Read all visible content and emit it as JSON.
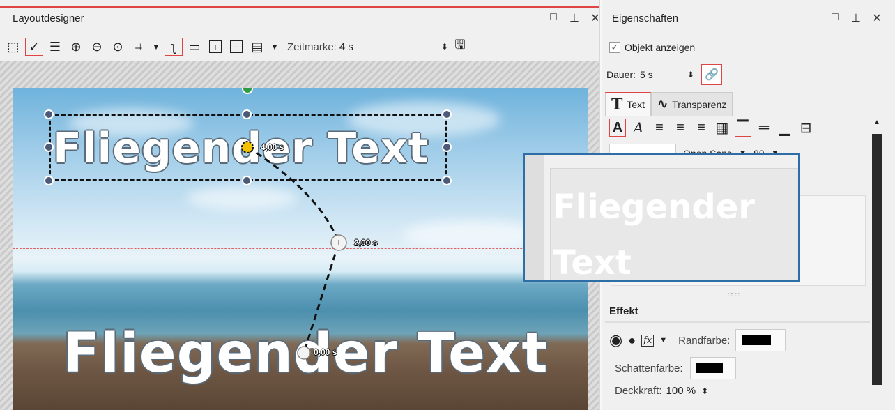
{
  "layoutdesigner": {
    "title": "Layoutdesigner",
    "window_buttons": [
      "□",
      "⊥",
      "✕"
    ],
    "toolbar": {
      "zeitmarke_label": "Zeitmarke:",
      "zeitmarke_value": "4 s"
    },
    "canvas": {
      "text_top": "Fliegender Text",
      "text_bottom": "Fliegender Text",
      "time_label_top": "4,00 s",
      "time_label_mid": "2,00 s",
      "time_label_bottom": "0,00 s"
    }
  },
  "eigenschaften": {
    "title": "Eigenschaften",
    "window_buttons": [
      "□",
      "⊥",
      "✕"
    ],
    "objekt_anzeigen": "Objekt anzeigen",
    "dauer_label": "Dauer:",
    "dauer_value": "5 s",
    "tabs": [
      {
        "icon": "T",
        "label": "Text"
      },
      {
        "icon": "∿",
        "label": "Transparenz"
      }
    ],
    "font_name": "Open Sans",
    "font_size": "80",
    "text_content": "Fliegender Text",
    "effekt_title": "Effekt",
    "randfarbe_label": "Randfarbe:",
    "schattenfarbe_label": "Schattenfarbe:",
    "deckkraft_label": "Deckkraft:",
    "deckkraft_value": "100 %"
  },
  "colors": {
    "accent_red": "#e04545",
    "zoom_border": "#2e6ea6",
    "rotation_handle": "#2e9b45",
    "keyframe_active": "#f2c200"
  }
}
